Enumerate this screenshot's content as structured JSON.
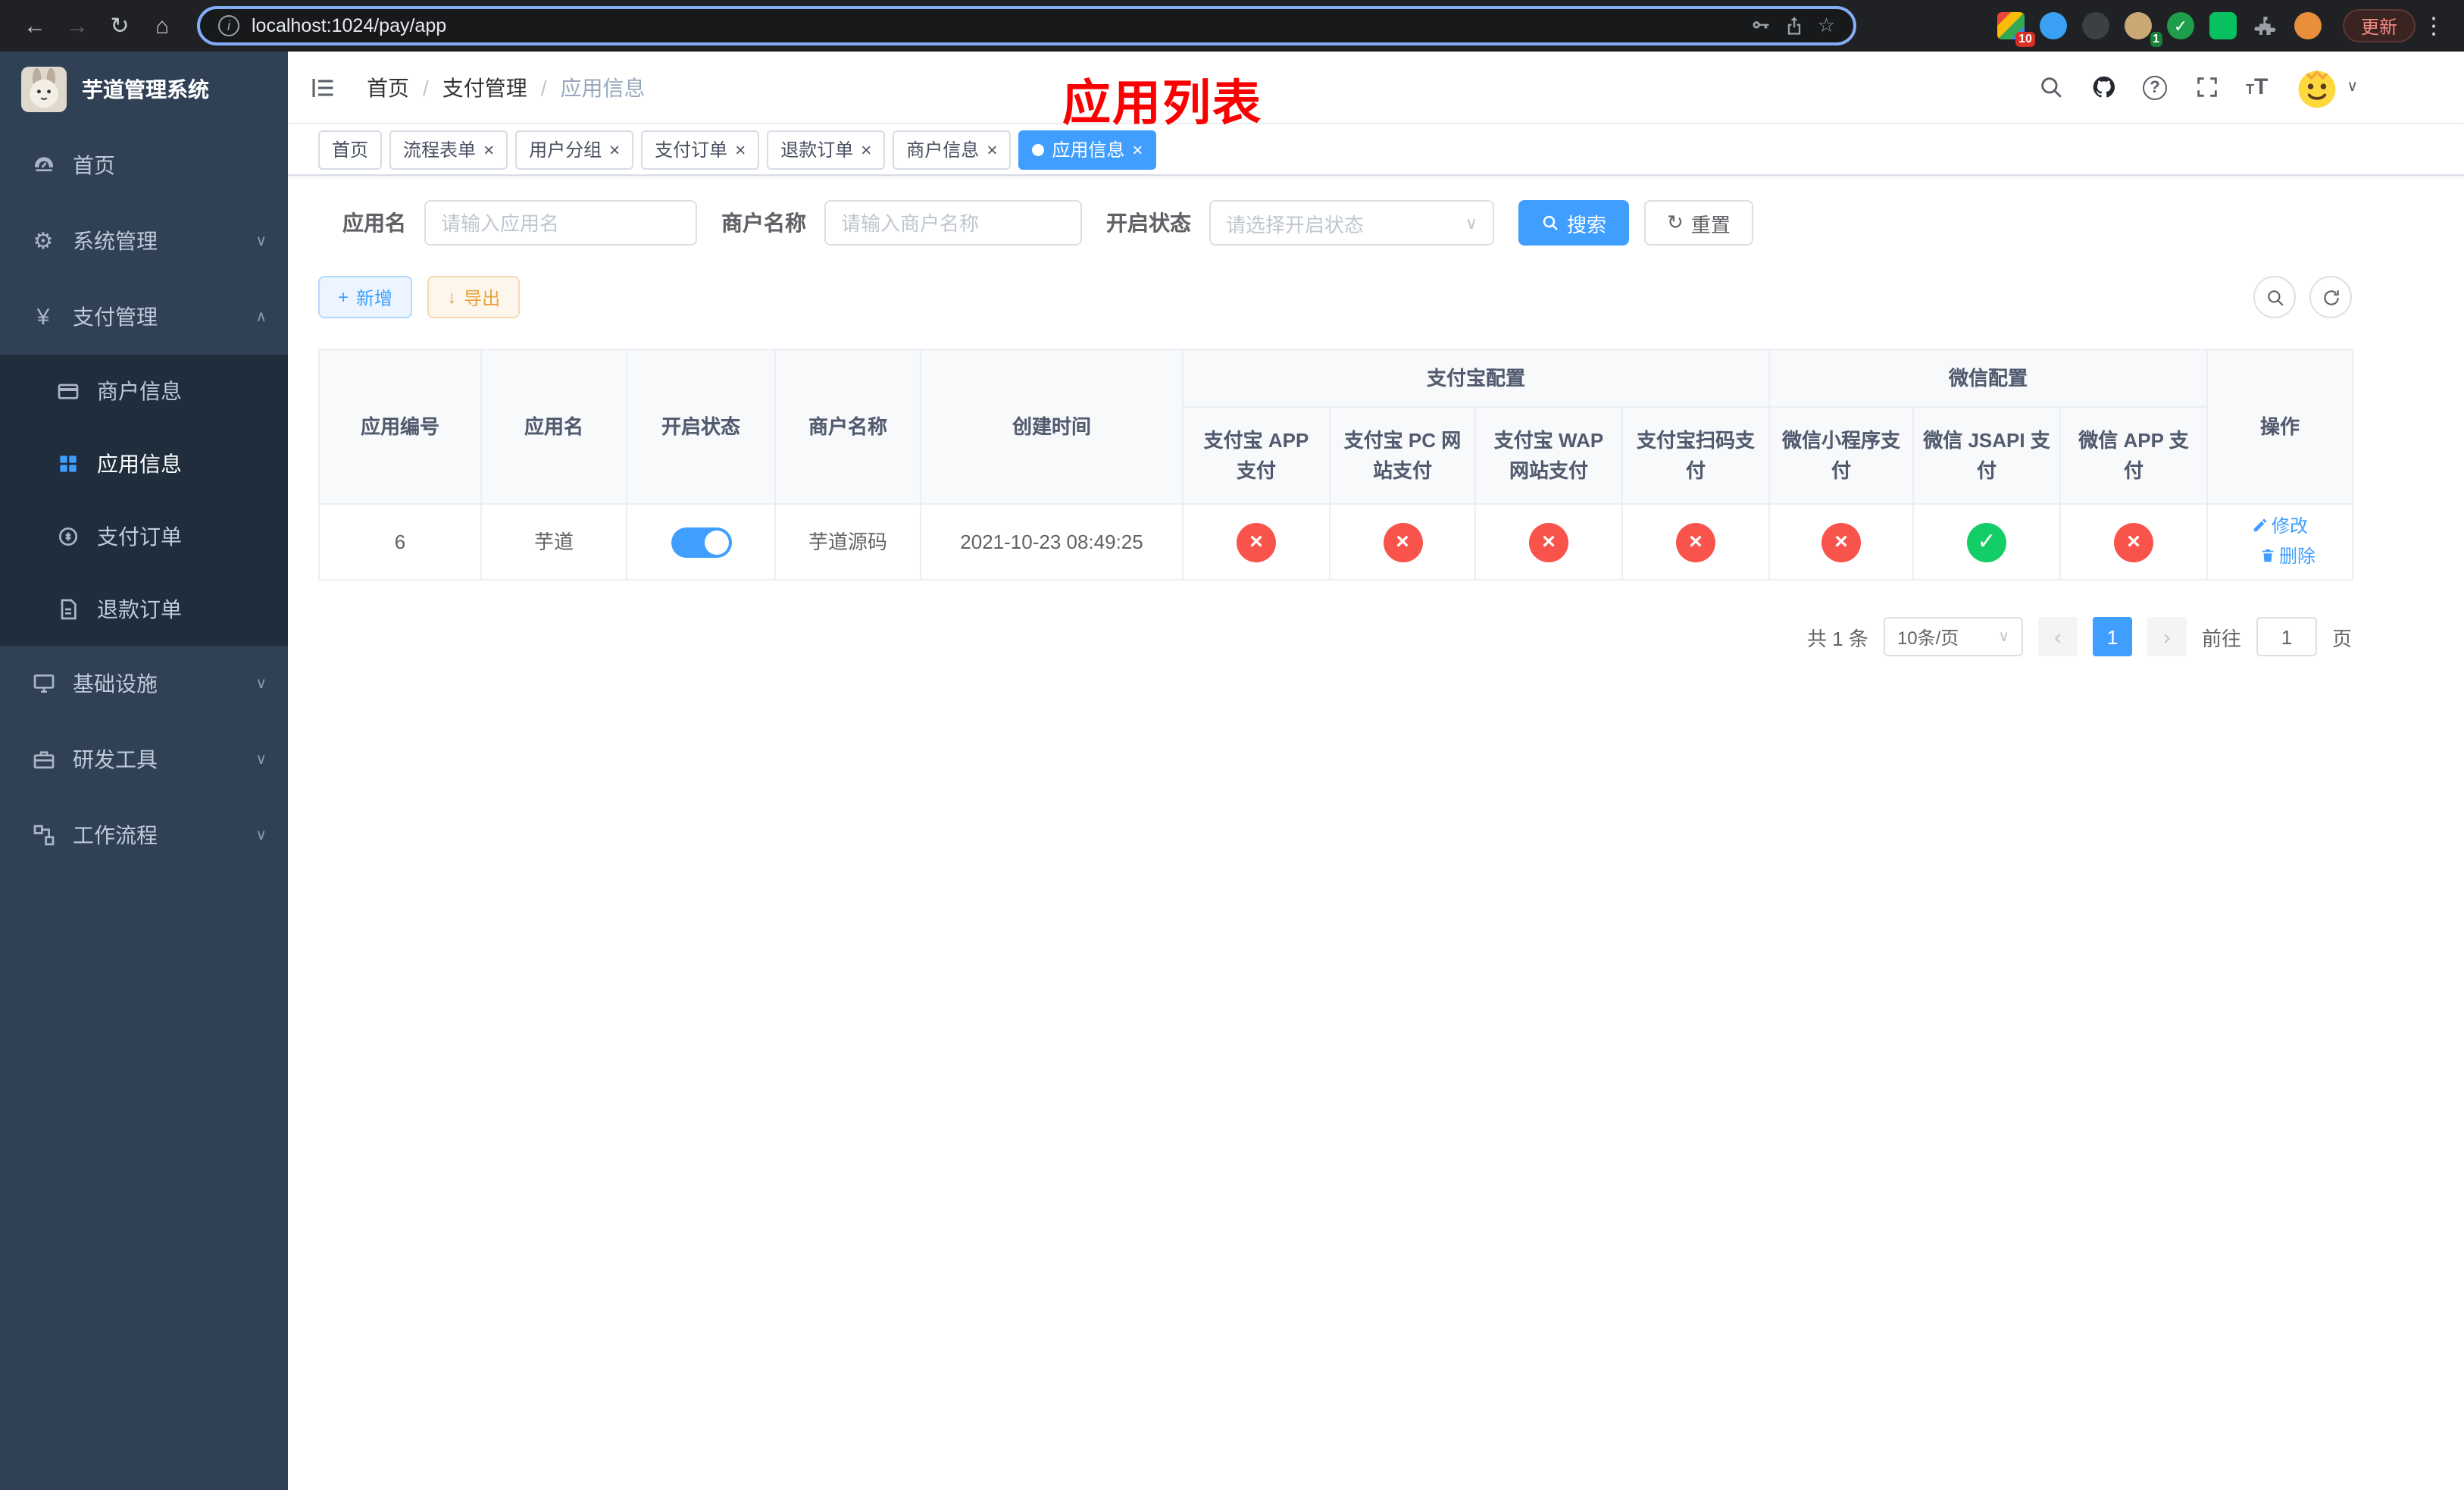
{
  "browser": {
    "url": "localhost:1024/pay/app",
    "update_label": "更新",
    "ext_badge_1": "10",
    "ext_badge_2": "1"
  },
  "icons": {
    "back": "←",
    "forward": "→",
    "reload": "↻",
    "home": "⌂",
    "info": "i",
    "star": "☆",
    "menu_dots": "⋮",
    "caret_down": "∨",
    "caret_up": "∧",
    "plus": "+",
    "download": "↓",
    "reset": "↻",
    "yen": "¥",
    "gear": "⚙",
    "check": "✓",
    "cross": "×",
    "prev": "‹",
    "next": "›"
  },
  "sidebar": {
    "title": "芋道管理系统",
    "home": "首页",
    "system": "系统管理",
    "payment": "支付管理",
    "merchant_info": "商户信息",
    "app_info": "应用信息",
    "pay_order": "支付订单",
    "refund_order": "退款订单",
    "infra": "基础设施",
    "dev_tools": "研发工具",
    "workflow": "工作流程"
  },
  "breadcrumb": {
    "home": "首页",
    "sep": "/",
    "payment": "支付管理",
    "current": "应用信息"
  },
  "annotation": "应用列表",
  "tabs": [
    {
      "label": "首页"
    },
    {
      "label": "流程表单",
      "close": "×"
    },
    {
      "label": "用户分组",
      "close": "×"
    },
    {
      "label": "支付订单",
      "close": "×"
    },
    {
      "label": "退款订单",
      "close": "×"
    },
    {
      "label": "商户信息",
      "close": "×"
    },
    {
      "label": "应用信息",
      "close": "×"
    }
  ],
  "search": {
    "app_name_label": "应用名",
    "app_name_placeholder": "请输入应用名",
    "merchant_label": "商户名称",
    "merchant_placeholder": "请输入商户名称",
    "status_label": "开启状态",
    "status_placeholder": "请选择开启状态",
    "search_button": "搜索",
    "reset_button": "重置"
  },
  "toolbar": {
    "add_button": "新增",
    "export_button": "导出"
  },
  "table": {
    "group_alipay": "支付宝配置",
    "group_wechat": "微信配置",
    "col_id": "应用编号",
    "col_name": "应用名",
    "col_status": "开启状态",
    "col_merchant": "商户名称",
    "col_created": "创建时间",
    "col_alipay_app": "支付宝 APP 支付",
    "col_alipay_pc": "支付宝 PC 网站支付",
    "col_alipay_wap": "支付宝 WAP 网站支付",
    "col_alipay_qr": "支付宝扫码支付",
    "col_wx_mini": "微信小程序支付",
    "col_wx_jsapi": "微信 JSAPI 支付",
    "col_wx_app": "微信 APP 支付",
    "col_actions": "操作",
    "row": {
      "id": "6",
      "name": "芋道",
      "merchant": "芋道源码",
      "created": "2021-10-23 08:49:25",
      "ch_alipay_app": "×",
      "ch_alipay_pc": "×",
      "ch_alipay_wap": "×",
      "ch_alipay_qr": "×",
      "ch_wx_mini": "×",
      "ch_wx_jsapi": "✓",
      "ch_wx_app": "×",
      "edit": "修改",
      "delete": "删除"
    }
  },
  "pagination": {
    "total": "共 1 条",
    "page_size": "10条/页",
    "page": "1",
    "goto_label": "前往",
    "goto_value": "1",
    "page_unit": "页"
  },
  "colors": {
    "primary": "#409eff",
    "fail": "#f9544b",
    "success": "#13ce66",
    "annotation_red": "#fb0000",
    "sidebar_bg": "#304156",
    "submenu_bg": "#1f2d3d"
  }
}
